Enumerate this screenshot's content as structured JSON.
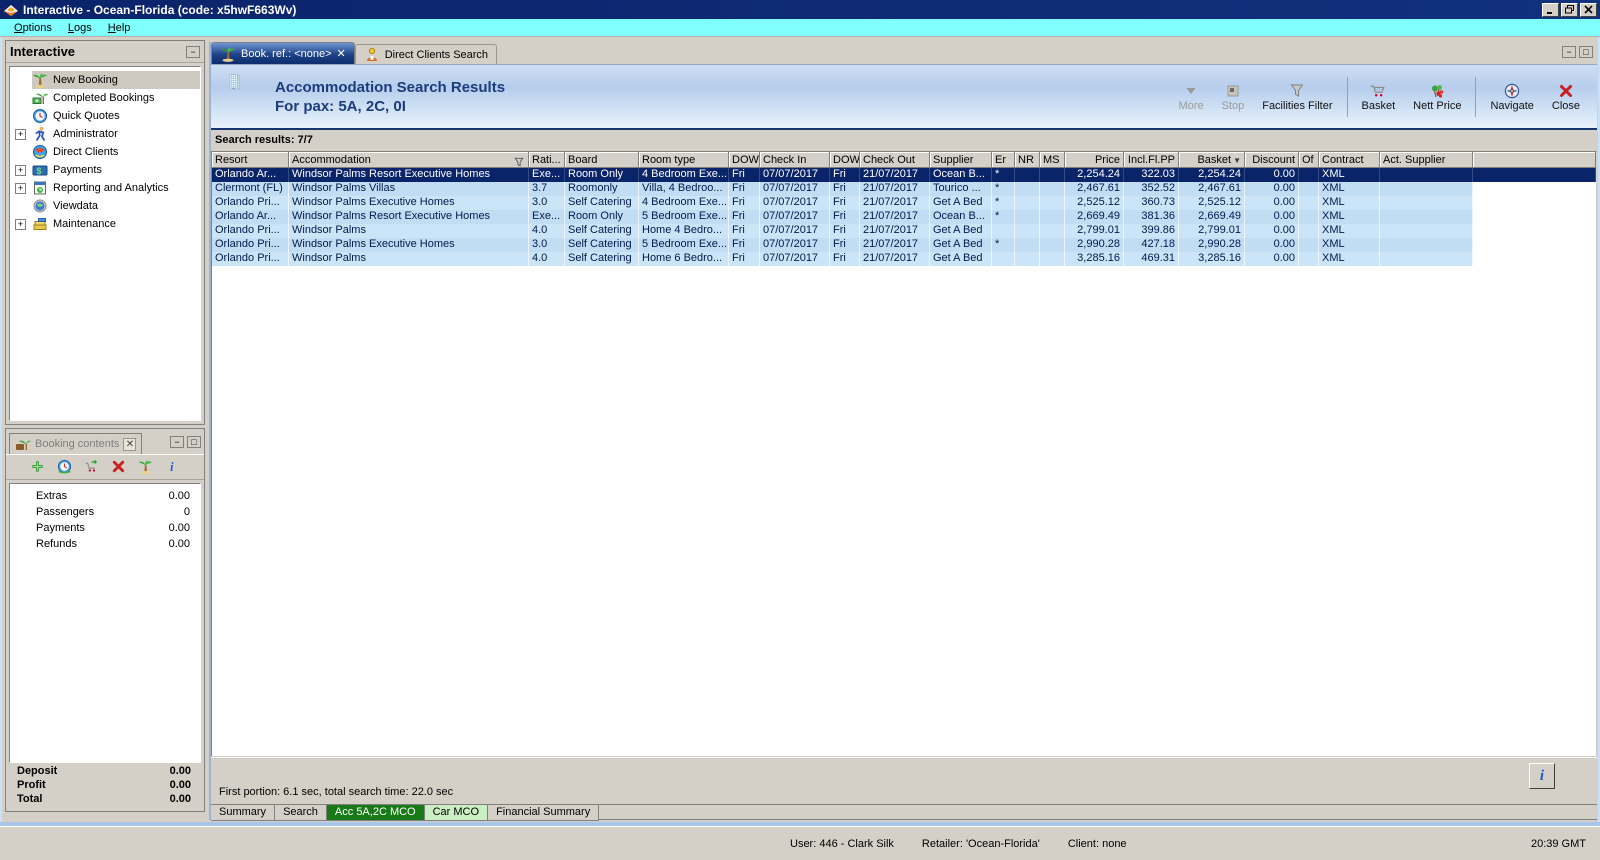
{
  "window": {
    "title": "Interactive - Ocean-Florida (code: x5hwF663Wv)",
    "controls": [
      "minimize-icon",
      "restore-icon",
      "close-icon"
    ],
    "status_user": "User: 446 - Clark Silk",
    "status_retailer": "Retailer: 'Ocean-Florida'",
    "status_client": "Client: none",
    "clock": "20:39 GMT"
  },
  "menu": {
    "items": [
      {
        "label": "Options"
      },
      {
        "label": "Logs"
      },
      {
        "label": "Help"
      }
    ]
  },
  "sidebar": {
    "title": "Interactive",
    "items": [
      {
        "label": "New Booking",
        "icon": "palm-tree-icon",
        "expandable": false,
        "selected": true
      },
      {
        "label": "Completed Bookings",
        "icon": "palm-money-icon",
        "expandable": false,
        "selected": false
      },
      {
        "label": "Quick Quotes",
        "icon": "clock-icon",
        "expandable": false,
        "selected": false
      },
      {
        "label": "Administrator",
        "icon": "administrator-icon",
        "expandable": true,
        "selected": false
      },
      {
        "label": "Direct Clients",
        "icon": "direct-clients-icon",
        "expandable": false,
        "selected": false
      },
      {
        "label": "Payments",
        "icon": "payments-icon",
        "expandable": true,
        "selected": false
      },
      {
        "label": "Reporting and Analytics",
        "icon": "reporting-icon",
        "expandable": true,
        "selected": false
      },
      {
        "label": "Viewdata",
        "icon": "viewdata-icon",
        "expandable": false,
        "selected": false
      },
      {
        "label": "Maintenance",
        "icon": "maintenance-icon",
        "expandable": true,
        "selected": false
      }
    ]
  },
  "booking_contents": {
    "title": "Booking contents",
    "toolbar_icons": [
      "add-icon",
      "quote-clock-icon",
      "basket-add-icon",
      "delete-icon",
      "palm-tree-icon",
      "info-icon"
    ],
    "rows": [
      {
        "label": "Extras",
        "value": "0.00"
      },
      {
        "label": "Passengers",
        "value": "0"
      },
      {
        "label": "Payments",
        "value": "0.00"
      },
      {
        "label": "Refunds",
        "value": "0.00"
      }
    ],
    "totals": [
      {
        "label": "Deposit",
        "value": "0.00"
      },
      {
        "label": "Profit",
        "value": "0.00"
      },
      {
        "label": "Total",
        "value": "0.00"
      }
    ]
  },
  "main": {
    "tabs": [
      {
        "label": "Book. ref.: <none>",
        "icon": "palm-tree-icon",
        "active": true,
        "closable": true
      },
      {
        "label": "Direct Clients Search",
        "icon": "client-person-icon",
        "active": false,
        "closable": false
      }
    ],
    "header": {
      "title": "Accommodation Search Results",
      "subtitle": "For pax: 5A, 2C, 0I",
      "icon": "building-icon"
    },
    "toolbar": [
      {
        "label": "More",
        "icon": "more-icon",
        "disabled": true,
        "group": 1
      },
      {
        "label": "Stop",
        "icon": "stop-icon",
        "disabled": true,
        "group": 1
      },
      {
        "label": "Facilities Filter",
        "icon": "facilities-filter-icon",
        "disabled": false,
        "group": 1
      },
      {
        "label": "Basket",
        "icon": "basket-icon",
        "disabled": false,
        "group": 2
      },
      {
        "label": "Nett Price",
        "icon": "nett-price-icon",
        "disabled": false,
        "group": 2
      },
      {
        "label": "Navigate",
        "icon": "navigate-icon",
        "disabled": false,
        "group": 3
      },
      {
        "label": "Close",
        "icon": "close-red-icon",
        "disabled": false,
        "group": 3
      }
    ],
    "results_label": "Search results: 7/7",
    "table": {
      "columns": [
        {
          "label": "Resort"
        },
        {
          "label": "Accommodation",
          "filter": true
        },
        {
          "label": "Rati..."
        },
        {
          "label": "Board"
        },
        {
          "label": "Room type"
        },
        {
          "label": "DOW"
        },
        {
          "label": "Check In"
        },
        {
          "label": "DOW"
        },
        {
          "label": "Check Out"
        },
        {
          "label": "Supplier"
        },
        {
          "label": "Er"
        },
        {
          "label": "NR"
        },
        {
          "label": "MS"
        },
        {
          "label": "Price",
          "num": true
        },
        {
          "label": "Incl.Fl.PP",
          "num": true
        },
        {
          "label": "Basket",
          "num": true,
          "sorted": true
        },
        {
          "label": "Discount",
          "num": true
        },
        {
          "label": "Of"
        },
        {
          "label": "Contract"
        },
        {
          "label": "Act. Supplier"
        }
      ],
      "rows": [
        {
          "selected": true,
          "cells": [
            "Orlando Ar...",
            "Windsor Palms Resort Executive Homes",
            "Exe...",
            "Room Only",
            "4 Bedroom Exe...",
            "Fri",
            "07/07/2017",
            "Fri",
            "21/07/2017",
            "Ocean B...",
            "*",
            "",
            "",
            "2,254.24",
            "322.03",
            "2,254.24",
            "0.00",
            "",
            "XML",
            ""
          ]
        },
        {
          "selected": false,
          "cells": [
            "Clermont (FL)",
            "Windsor Palms Villas",
            "3.7",
            "Roomonly",
            "Villa, 4 Bedroo...",
            "Fri",
            "07/07/2017",
            "Fri",
            "21/07/2017",
            "Tourico ...",
            "*",
            "",
            "",
            "2,467.61",
            "352.52",
            "2,467.61",
            "0.00",
            "",
            "XML",
            ""
          ]
        },
        {
          "selected": false,
          "cells": [
            "Orlando Pri...",
            "Windsor Palms Executive Homes",
            "3.0",
            "Self Catering",
            "4 Bedroom Exe...",
            "Fri",
            "07/07/2017",
            "Fri",
            "21/07/2017",
            "Get A Bed",
            "*",
            "",
            "",
            "2,525.12",
            "360.73",
            "2,525.12",
            "0.00",
            "",
            "XML",
            ""
          ]
        },
        {
          "selected": false,
          "cells": [
            "Orlando Ar...",
            "Windsor Palms Resort Executive Homes",
            "Exe...",
            "Room Only",
            "5 Bedroom Exe...",
            "Fri",
            "07/07/2017",
            "Fri",
            "21/07/2017",
            "Ocean B...",
            "*",
            "",
            "",
            "2,669.49",
            "381.36",
            "2,669.49",
            "0.00",
            "",
            "XML",
            ""
          ]
        },
        {
          "selected": false,
          "cells": [
            "Orlando Pri...",
            "Windsor Palms",
            "4.0",
            "Self Catering",
            "Home 4 Bedro...",
            "Fri",
            "07/07/2017",
            "Fri",
            "21/07/2017",
            "Get A Bed",
            "",
            "",
            "",
            "2,799.01",
            "399.86",
            "2,799.01",
            "0.00",
            "",
            "XML",
            ""
          ]
        },
        {
          "selected": false,
          "cells": [
            "Orlando Pri...",
            "Windsor Palms Executive Homes",
            "3.0",
            "Self Catering",
            "5 Bedroom Exe...",
            "Fri",
            "07/07/2017",
            "Fri",
            "21/07/2017",
            "Get A Bed",
            "*",
            "",
            "",
            "2,990.28",
            "427.18",
            "2,990.28",
            "0.00",
            "",
            "XML",
            ""
          ]
        },
        {
          "selected": false,
          "cells": [
            "Orlando Pri...",
            "Windsor Palms",
            "4.0",
            "Self Catering",
            "Home 6 Bedro...",
            "Fri",
            "07/07/2017",
            "Fri",
            "21/07/2017",
            "Get A Bed",
            "",
            "",
            "",
            "3,285.16",
            "469.31",
            "3,285.16",
            "0.00",
            "",
            "XML",
            ""
          ]
        }
      ]
    },
    "status_text": "First portion: 6.1 sec, total search time: 22.0 sec",
    "info_button": "i",
    "bottom_tabs": [
      {
        "label": "Summary",
        "style": "plain"
      },
      {
        "label": "Search",
        "style": "plain"
      },
      {
        "label": "Acc 5A,2C MCO",
        "style": "dark-green"
      },
      {
        "label": "Car MCO",
        "style": "light-green"
      },
      {
        "label": "Financial Summary",
        "style": "plain"
      }
    ]
  }
}
